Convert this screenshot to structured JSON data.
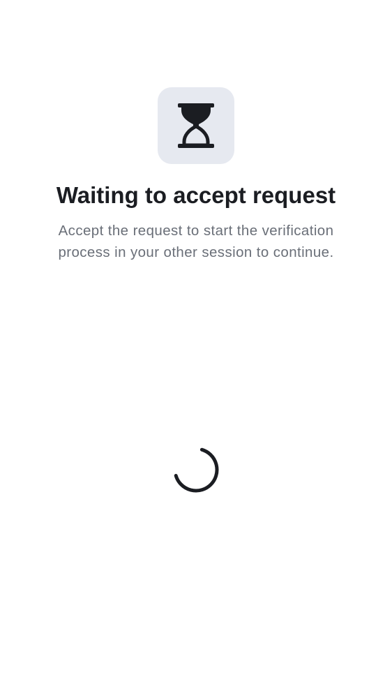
{
  "header": {
    "icon": "hourglass-icon",
    "title": "Waiting to accept request",
    "subtitle": "Accept the request to start the verification process in your other session to continue."
  },
  "loading": {
    "indicator": "loading-spinner-icon"
  },
  "colors": {
    "background": "#ffffff",
    "icon_tile": "#e6e9f0",
    "icon": "#1b1d22",
    "title": "#1b1d22",
    "subtitle": "#6a6f78",
    "spinner": "#1b1d22"
  }
}
